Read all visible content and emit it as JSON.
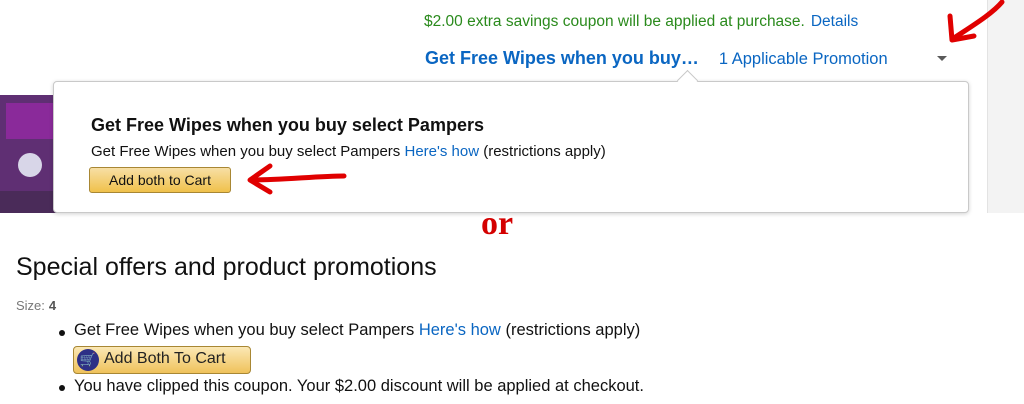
{
  "top_screenshot": {
    "coupon_text": "$2.00 extra savings coupon will be applied at purchase.",
    "details_link": "Details",
    "promo_title": "Get Free Wipes when you buy…",
    "promo_count": "1 Applicable Promotion",
    "popover": {
      "title": "Get Free Wipes when you buy select Pampers",
      "desc_prefix": "Get Free Wipes when you buy select Pampers",
      "desc_link": "Here's how",
      "desc_suffix": "(restrictions apply)",
      "button_label": "Add both to Cart"
    }
  },
  "divider_text": "or",
  "bottom_screenshot": {
    "heading": "Special offers and product promotions",
    "size_label": "Size:",
    "size_value": "4",
    "offers": [
      {
        "prefix": "Get Free Wipes when you buy select Pampers",
        "link": "Here's how",
        "suffix": "(restrictions apply)"
      },
      {
        "text": "You have clipped this coupon. Your $2.00 discount will be applied at checkout."
      }
    ],
    "button_label": "Add Both To Cart"
  },
  "colors": {
    "coupon_green": "#2a8a1c",
    "link_blue": "#0a66c2",
    "annotation_red": "#e00000",
    "button_gold": "#f0c14b"
  },
  "icons": [
    "caret-down-icon",
    "cart-icon",
    "red-arrow-annotation"
  ]
}
